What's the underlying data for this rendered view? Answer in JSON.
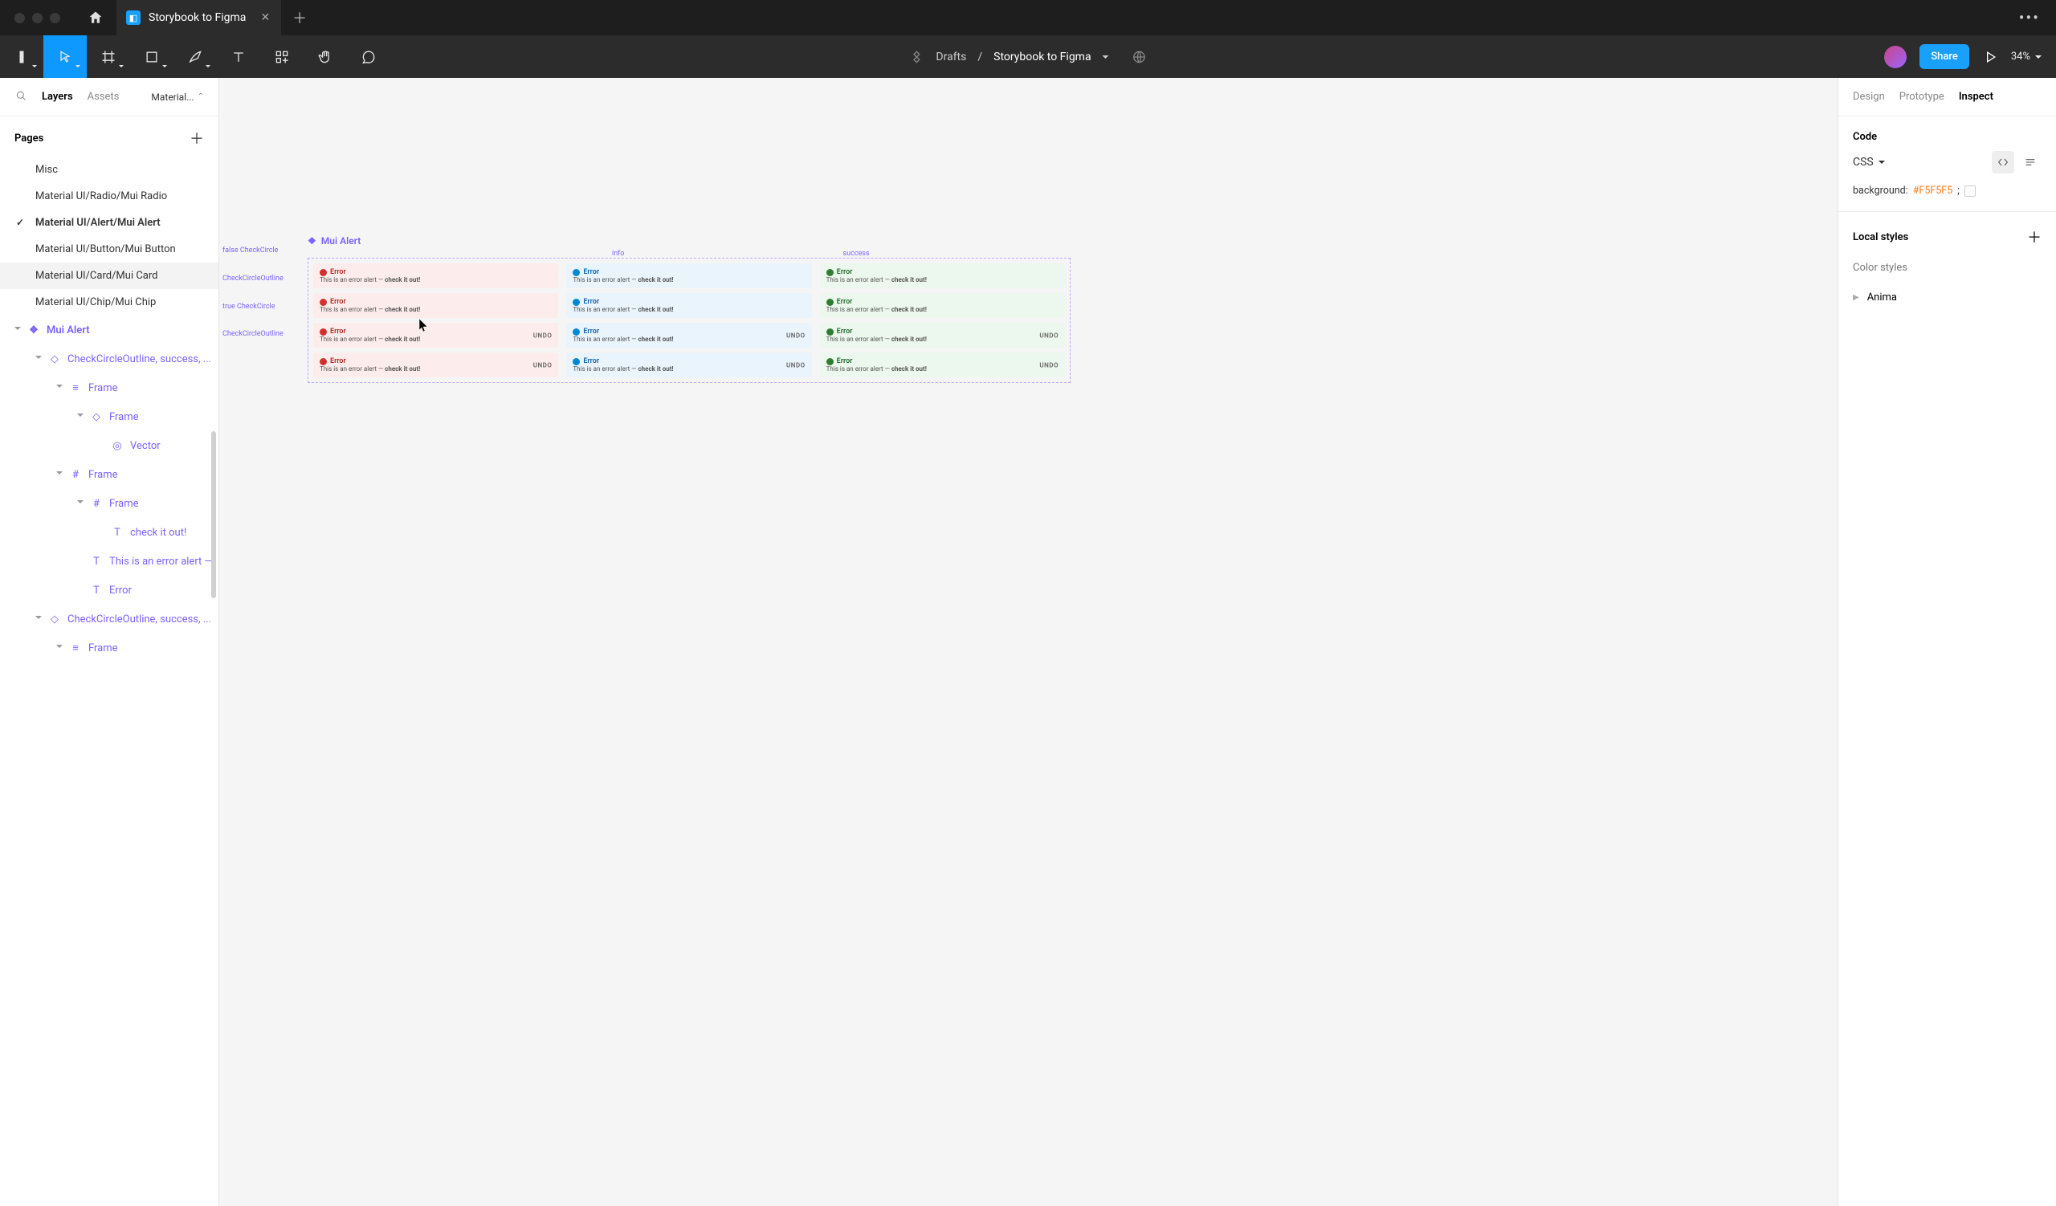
{
  "titlebar": {
    "tab_title": "Storybook to Figma"
  },
  "toolbar": {
    "breadcrumb_root": "Drafts",
    "breadcrumb_sep": "/",
    "file_name": "Storybook to Figma",
    "share_label": "Share",
    "zoom": "34%"
  },
  "left_panel": {
    "tab_layers": "Layers",
    "tab_assets": "Assets",
    "page_picker": "Material...",
    "pages_header": "Pages",
    "pages": [
      {
        "label": "Misc",
        "selected": false
      },
      {
        "label": "Material UI/Radio/Mui Radio",
        "selected": false
      },
      {
        "label": "Material UI/Alert/Mui Alert",
        "selected": true
      },
      {
        "label": "Material UI/Button/Mui Button",
        "selected": false
      },
      {
        "label": "Material UI/Card/Mui Card",
        "selected": false,
        "hover": true
      },
      {
        "label": "Material UI/Chip/Mui Chip",
        "selected": false
      }
    ],
    "layers": [
      {
        "label": "Mui Alert",
        "icon": "component-set",
        "indent": 0,
        "bold": true,
        "open": true
      },
      {
        "label": "CheckCircleOutline, success, ...",
        "icon": "variant",
        "indent": 1,
        "open": true
      },
      {
        "label": "Frame",
        "icon": "autolayout",
        "indent": 2,
        "open": true
      },
      {
        "label": "Frame",
        "icon": "instance",
        "indent": 3,
        "open": true
      },
      {
        "label": "Vector",
        "icon": "vector",
        "indent": 4
      },
      {
        "label": "Frame",
        "icon": "frame",
        "indent": 2,
        "open": true
      },
      {
        "label": "Frame",
        "icon": "frame",
        "indent": 3,
        "open": true
      },
      {
        "label": "check it out!",
        "icon": "text",
        "indent": 4
      },
      {
        "label": "This is an error alert —",
        "icon": "text",
        "indent": 3
      },
      {
        "label": "Error",
        "icon": "text",
        "indent": 3
      },
      {
        "label": "CheckCircleOutline, success, ...",
        "icon": "variant",
        "indent": 1,
        "open": true
      },
      {
        "label": "Frame",
        "icon": "autolayout",
        "indent": 2,
        "open": true
      }
    ]
  },
  "right_panel": {
    "tab_design": "Design",
    "tab_prototype": "Prototype",
    "tab_inspect": "Inspect",
    "code_header": "Code",
    "code_lang": "CSS",
    "code_prop": "background:",
    "code_value": "#F5F5F5",
    "code_semi": ";",
    "local_styles_header": "Local styles",
    "color_styles_sub": "Color styles",
    "anima_item": "Anima"
  },
  "canvas": {
    "frame_label": "Mui Alert",
    "column_headers": [
      "",
      "info",
      "success"
    ],
    "left_side_labels": [
      "false CheckCircle",
      "CheckCircleOutline",
      "true  CheckCircle",
      "CheckCircleOutline"
    ],
    "alert": {
      "title": "Error",
      "body_prefix": "This is an error alert — ",
      "body_bold": "check it out!",
      "undo": "UNDO"
    }
  }
}
